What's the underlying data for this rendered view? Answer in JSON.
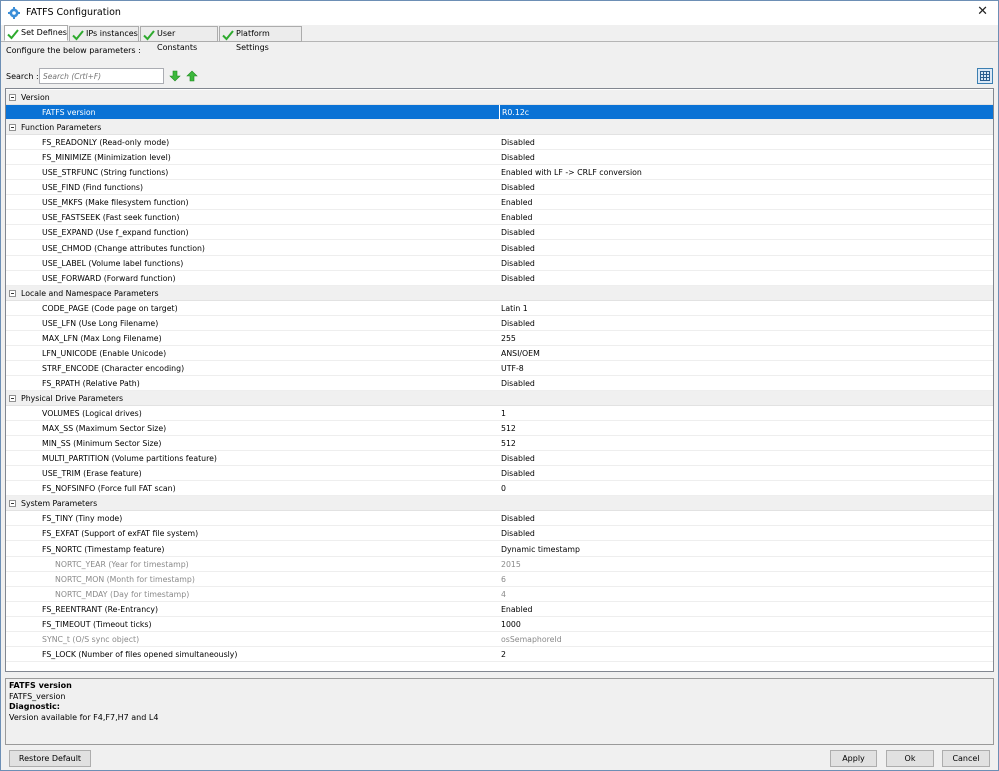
{
  "window": {
    "title": "FATFS Configuration",
    "close_glyph": "✕",
    "icon": "gear-icon"
  },
  "tabs": [
    {
      "label": "Set Defines",
      "icon": "check-icon"
    },
    {
      "label": "IPs instances",
      "icon": "check-icon"
    },
    {
      "label": "User Constants",
      "icon": "check-icon"
    },
    {
      "label": "Platform Settings",
      "icon": "check-icon"
    }
  ],
  "hint": "Configure the below parameters :",
  "search": {
    "label": "Search :",
    "placeholder": "Search (Crtl+F)",
    "next_icon": "arrow-down-icon",
    "prev_icon": "arrow-up-icon"
  },
  "rows": [
    {
      "type": "category",
      "name": "Version"
    },
    {
      "type": "param",
      "name": "FATFS version",
      "value": "R0.12c",
      "selected": true
    },
    {
      "type": "category",
      "name": "Function Parameters"
    },
    {
      "type": "param",
      "name": "FS_READONLY (Read-only mode)",
      "value": "Disabled"
    },
    {
      "type": "param",
      "name": "FS_MINIMIZE (Minimization level)",
      "value": "Disabled"
    },
    {
      "type": "param",
      "name": "USE_STRFUNC (String functions)",
      "value": "Enabled with LF -> CRLF conversion"
    },
    {
      "type": "param",
      "name": "USE_FIND (Find functions)",
      "value": "Disabled"
    },
    {
      "type": "param",
      "name": "USE_MKFS (Make filesystem function)",
      "value": "Enabled"
    },
    {
      "type": "param",
      "name": "USE_FASTSEEK (Fast seek function)",
      "value": "Enabled"
    },
    {
      "type": "param",
      "name": "USE_EXPAND (Use f_expand function)",
      "value": "Disabled"
    },
    {
      "type": "param",
      "name": "USE_CHMOD (Change attributes function)",
      "value": "Disabled"
    },
    {
      "type": "param",
      "name": "USE_LABEL (Volume label functions)",
      "value": "Disabled"
    },
    {
      "type": "param",
      "name": "USE_FORWARD (Forward function)",
      "value": "Disabled"
    },
    {
      "type": "category",
      "name": "Locale and Namespace Parameters"
    },
    {
      "type": "param",
      "name": "CODE_PAGE (Code page on target)",
      "value": "Latin 1"
    },
    {
      "type": "param",
      "name": "USE_LFN (Use Long Filename)",
      "value": "Disabled"
    },
    {
      "type": "param",
      "name": "MAX_LFN (Max Long Filename)",
      "value": "255"
    },
    {
      "type": "param",
      "name": "LFN_UNICODE (Enable Unicode)",
      "value": "ANSI/OEM"
    },
    {
      "type": "param",
      "name": "STRF_ENCODE (Character encoding)",
      "value": "UTF-8"
    },
    {
      "type": "param",
      "name": "FS_RPATH (Relative Path)",
      "value": "Disabled"
    },
    {
      "type": "category",
      "name": "Physical Drive Parameters"
    },
    {
      "type": "param",
      "name": "VOLUMES (Logical drives)",
      "value": "1"
    },
    {
      "type": "param",
      "name": "MAX_SS (Maximum Sector Size)",
      "value": "512"
    },
    {
      "type": "param",
      "name": "MIN_SS (Minimum Sector Size)",
      "value": "512"
    },
    {
      "type": "param",
      "name": "MULTI_PARTITION (Volume partitions feature)",
      "value": "Disabled"
    },
    {
      "type": "param",
      "name": "USE_TRIM (Erase feature)",
      "value": "Disabled"
    },
    {
      "type": "param",
      "name": "FS_NOFSINFO (Force full FAT scan)",
      "value": "0"
    },
    {
      "type": "category",
      "name": "System Parameters"
    },
    {
      "type": "param",
      "name": "FS_TINY (Tiny mode)",
      "value": "Disabled"
    },
    {
      "type": "param",
      "name": "FS_EXFAT (Support of exFAT file system)",
      "value": "Disabled"
    },
    {
      "type": "param",
      "name": "FS_NORTC (Timestamp feature)",
      "value": "Dynamic timestamp"
    },
    {
      "type": "sub",
      "name": "NORTC_YEAR (Year for timestamp)",
      "value": "2015",
      "disabled": true
    },
    {
      "type": "sub",
      "name": "NORTC_MON (Month for timestamp)",
      "value": "6",
      "disabled": true
    },
    {
      "type": "sub",
      "name": "NORTC_MDAY (Day for timestamp)",
      "value": "4",
      "disabled": true
    },
    {
      "type": "param",
      "name": "FS_REENTRANT (Re-Entrancy)",
      "value": "Enabled"
    },
    {
      "type": "param",
      "name": "FS_TIMEOUT (Timeout ticks)",
      "value": "1000"
    },
    {
      "type": "param",
      "name": "SYNC_t (O/S sync object)",
      "value": "osSemaphoreId",
      "disabled": true
    },
    {
      "type": "param",
      "name": "FS_LOCK (Number of files opened simultaneously)",
      "value": "2"
    }
  ],
  "description": {
    "title": "FATFS version",
    "define": "FATFS_version",
    "diagnostic_label": "Diagnostic:",
    "diagnostic_text": "Version available for F4,F7,H7 and L4"
  },
  "buttons": {
    "restore": "Restore Default",
    "apply": "Apply",
    "ok": "Ok",
    "cancel": "Cancel"
  },
  "colors": {
    "selection": "#0a72d5",
    "check": "#2eaa2e",
    "arrows": "#3cb83c",
    "disabled_text": "#8a8a8a"
  }
}
